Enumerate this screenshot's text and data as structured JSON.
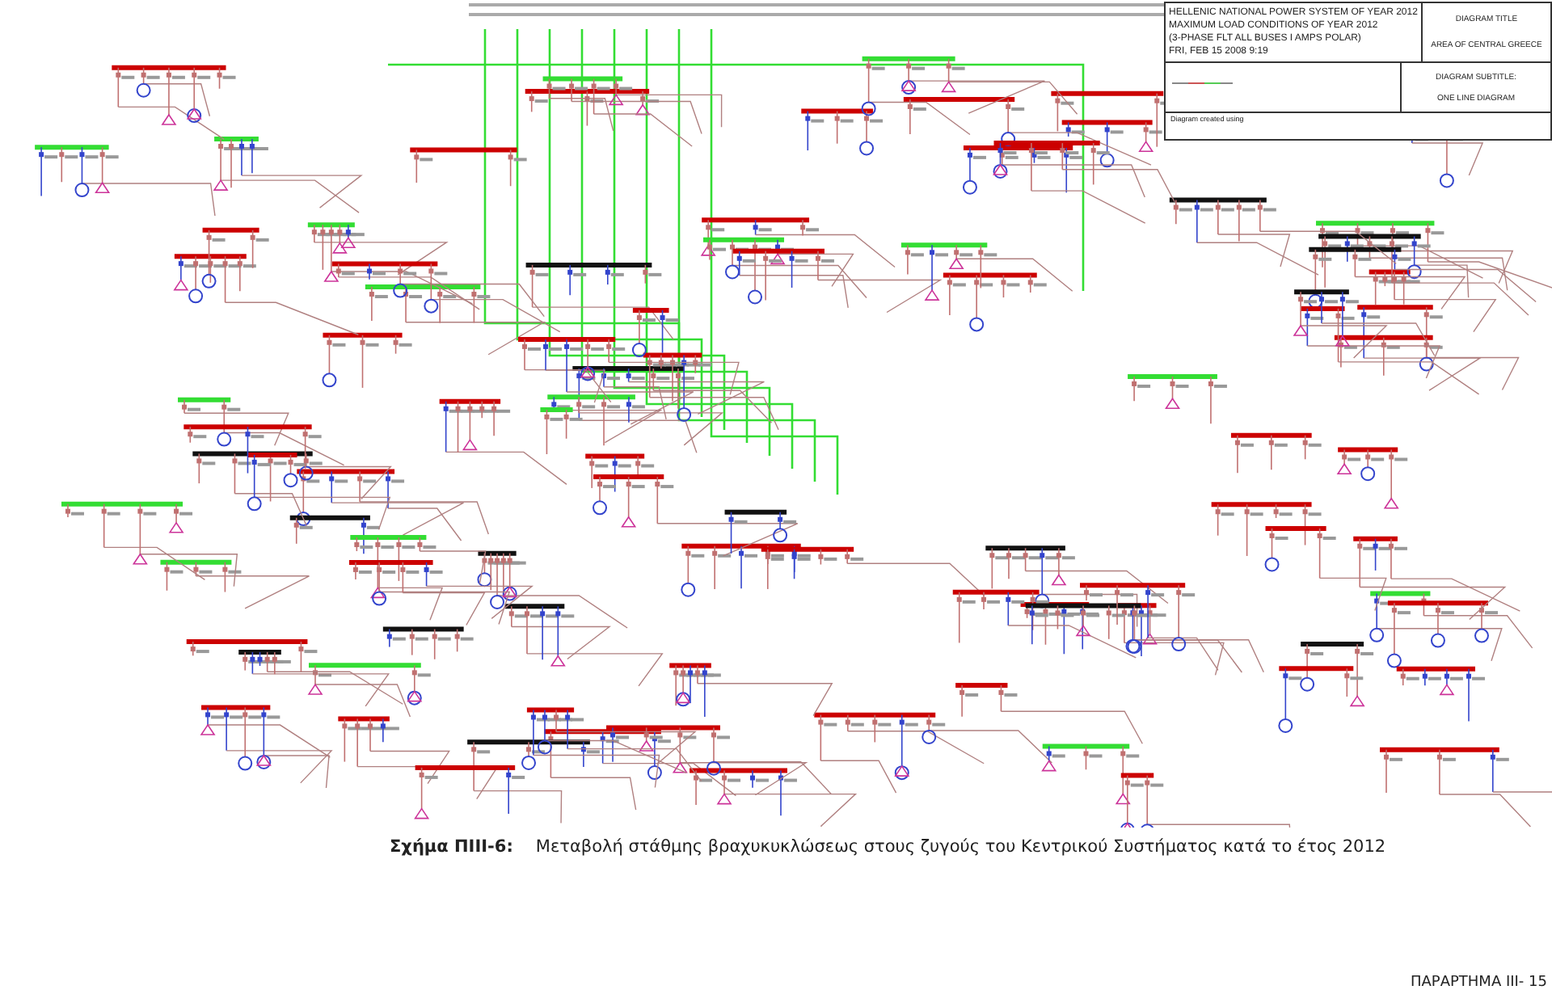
{
  "title_block": {
    "heading_lines": [
      "HELLENIC NATIONAL POWER SYSTEM OF YEAR 2012",
      "MAXIMUM LOAD CONDITIONS OF YEAR 2012",
      "(3-PHASE FLT ALL BUSES  I  AMPS POLAR)",
      "FRI, FEB 15 2008   9:19"
    ],
    "diagram_title_label": "DIAGRAM TITLE",
    "diagram_title": "AREA OF CENTRAL GREECE",
    "subtitle_label": "DIAGRAM SUBTITLE:",
    "subtitle": "ONE LINE DIAGRAM",
    "created_note": "Diagram created using"
  },
  "caption": {
    "label": "Σχήμα ΠΙΙΙ-6:",
    "text": "Μεταβολή στάθμης βραχυκυκλώσεως στους ζυγούς του Κεντρικού Συστήματος κατά το έτος 2012"
  },
  "footer": {
    "page": "ΠΑΡΑΡΤΗΜΑ ΙΙΙ- 15"
  }
}
